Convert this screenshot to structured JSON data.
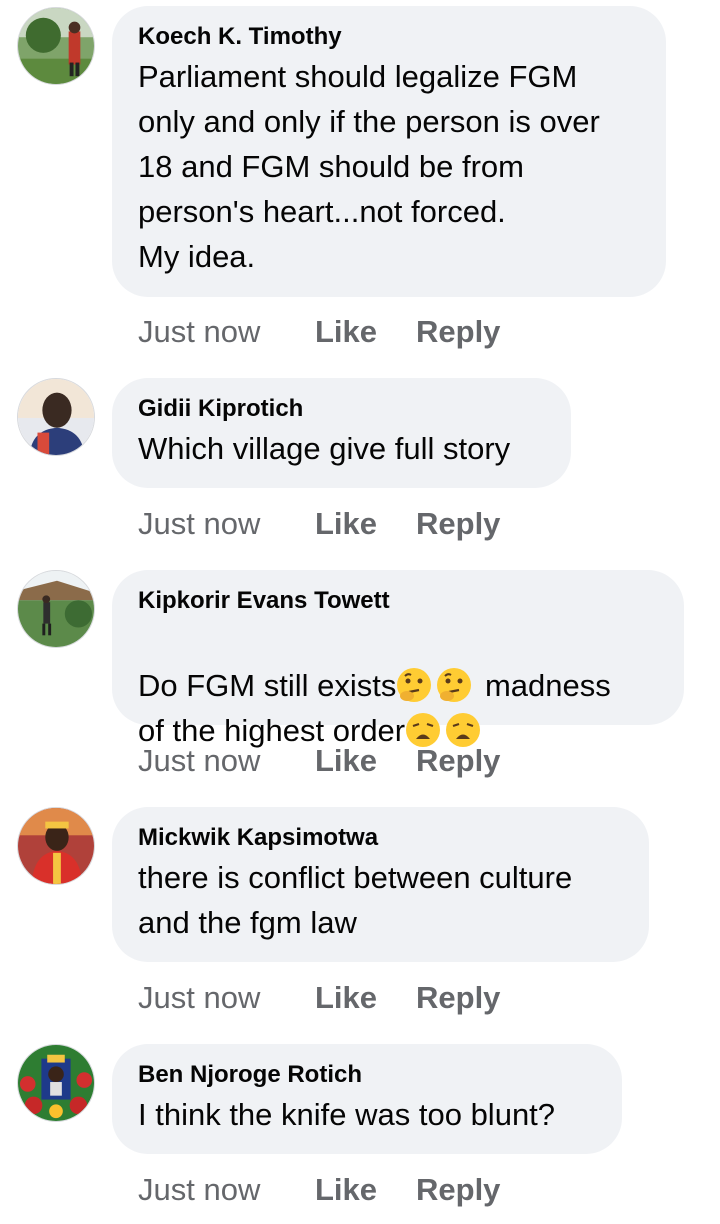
{
  "comments": [
    {
      "author": "Koech K. Timothy",
      "text": "Parliament should legalize FGM\nonly and only if the person is over\n18 and FGM should be from\nperson's heart...not forced.\nMy idea.",
      "time": "Just now",
      "like": "Like",
      "reply": "Reply",
      "avatar": "avatar-koech"
    },
    {
      "author": "Gidii Kiprotich",
      "text": "Which village give full story",
      "time": "Just now",
      "like": "Like",
      "reply": "Reply",
      "avatar": "avatar-gidii"
    },
    {
      "author": "Kipkorir Evans Towett",
      "text_part1": "Do FGM still exists",
      "text_part2": " madness",
      "text_part3": "of the highest order",
      "emoji_1": "thinking-face-emoji",
      "emoji_2": "weary-face-emoji",
      "time": "Just now",
      "like": "Like",
      "reply": "Reply",
      "avatar": "avatar-kipkorir"
    },
    {
      "author": "Mickwik Kapsimotwa",
      "text": "there is conflict between culture\nand the fgm law",
      "time": "Just now",
      "like": "Like",
      "reply": "Reply",
      "avatar": "avatar-mickwik"
    },
    {
      "author": "Ben Njoroge Rotich",
      "text": "I think the knife was too blunt?",
      "time": "Just now",
      "like": "Like",
      "reply": "Reply",
      "avatar": "avatar-ben"
    }
  ],
  "colors": {
    "bubble": "#f0f2f5",
    "meta_text": "#65676b",
    "body_text": "#050505"
  }
}
